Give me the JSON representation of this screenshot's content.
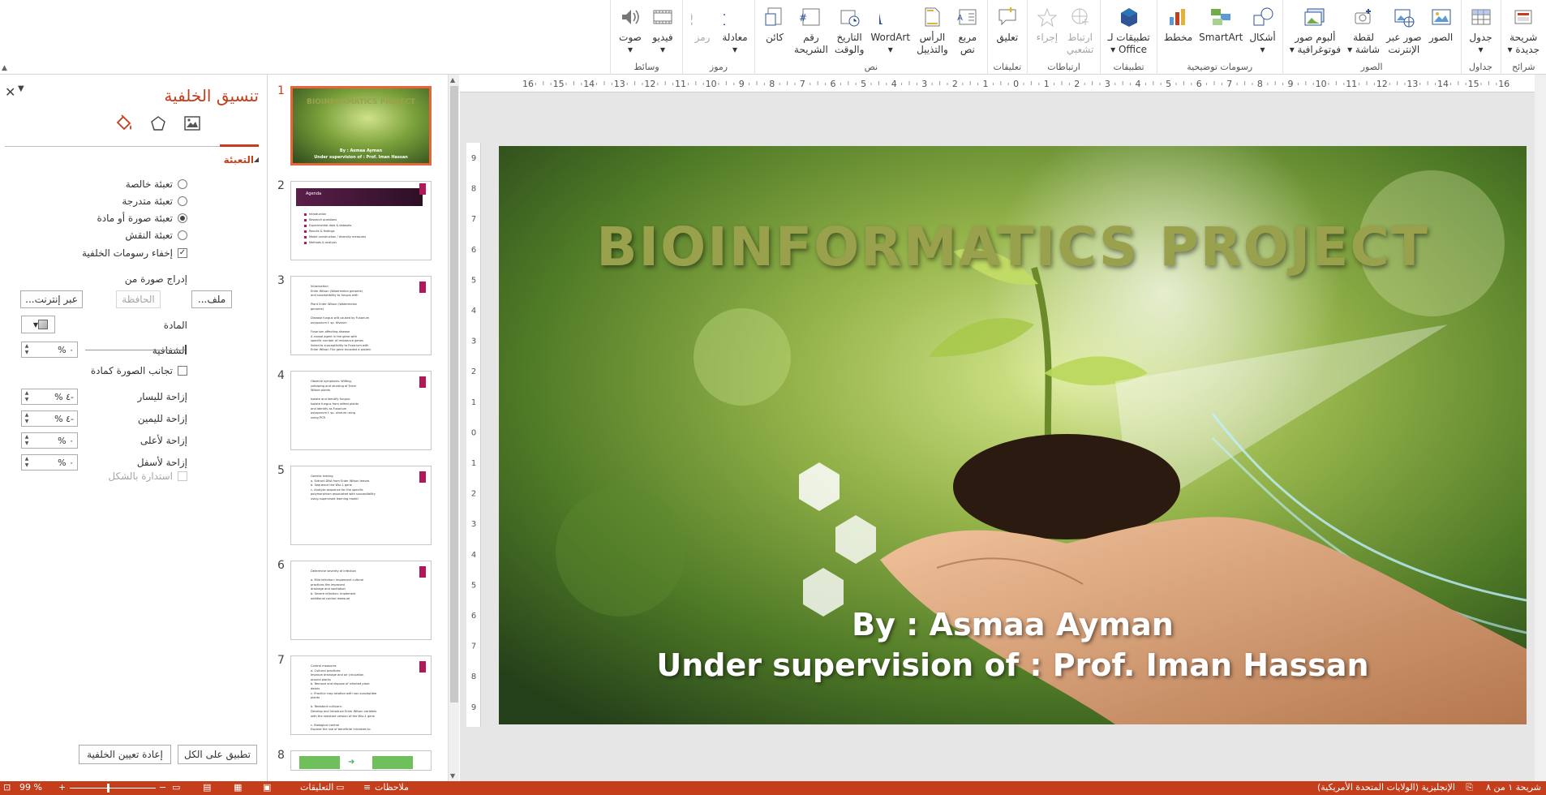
{
  "ribbon": {
    "groups": [
      {
        "label": "شرائح",
        "items": [
          {
            "name": "new-slide",
            "icon": "new-slide-icon",
            "label": "شريحة\nجديدة ▾"
          }
        ]
      },
      {
        "label": "جداول",
        "items": [
          {
            "name": "table",
            "icon": "table-icon",
            "label": "جدول\n▾"
          }
        ]
      },
      {
        "label": "الصور",
        "items": [
          {
            "name": "pictures",
            "icon": "picture-icon",
            "label": "الصور"
          },
          {
            "name": "online-pictures",
            "icon": "online-picture-icon",
            "label": "صور عبر\nالإنترنت"
          },
          {
            "name": "screenshot",
            "icon": "screenshot-icon",
            "label": "لقطة\nشاشة ▾"
          },
          {
            "name": "photo-album",
            "icon": "photo-album-icon",
            "label": "ألبوم صور\nفوتوغرافية ▾"
          }
        ]
      },
      {
        "label": "رسومات توضيحية",
        "items": [
          {
            "name": "shapes",
            "icon": "shapes-icon",
            "label": "أشكال\n▾"
          },
          {
            "name": "smartart",
            "icon": "smartart-icon",
            "label": "SmartArt"
          },
          {
            "name": "chart",
            "icon": "chart-icon",
            "label": "مخطط"
          }
        ]
      },
      {
        "label": "تطبيقات",
        "items": [
          {
            "name": "office-apps",
            "icon": "office-apps-icon",
            "label": "تطبيقات لـ\nOffice ▾"
          }
        ]
      },
      {
        "label": "ارتباطات",
        "items": [
          {
            "name": "hyperlink",
            "icon": "hyperlink-icon",
            "label": "ارتباط\nتشعبي",
            "disabled": true
          },
          {
            "name": "action",
            "icon": "action-icon",
            "label": "إجراء",
            "disabled": true
          }
        ]
      },
      {
        "label": "تعليقات",
        "items": [
          {
            "name": "comment",
            "icon": "comment-icon",
            "label": "تعليق"
          }
        ]
      },
      {
        "label": "نص",
        "items": [
          {
            "name": "text-box",
            "icon": "text-box-icon",
            "label": "مربع\nنص"
          },
          {
            "name": "header-footer",
            "icon": "header-footer-icon",
            "label": "الرأس\nوالتذييل"
          },
          {
            "name": "wordart",
            "icon": "wordart-icon",
            "label": "WordArt\n▾"
          },
          {
            "name": "date-time",
            "icon": "date-time-icon",
            "label": "التاريخ\nوالوقت"
          },
          {
            "name": "slide-number",
            "icon": "slide-number-icon",
            "label": "رقم\nالشريحة"
          },
          {
            "name": "object",
            "icon": "object-icon",
            "label": "كائن"
          }
        ]
      },
      {
        "label": "رموز",
        "items": [
          {
            "name": "equation",
            "icon": "equation-icon",
            "label": "معادلة\n▾"
          },
          {
            "name": "symbol",
            "icon": "symbol-icon",
            "label": "رمز",
            "disabled": true
          }
        ]
      },
      {
        "label": "وسائط",
        "items": [
          {
            "name": "video",
            "icon": "video-icon",
            "label": "فيديو\n▾"
          },
          {
            "name": "audio",
            "icon": "audio-icon",
            "label": "صوت\n▾"
          }
        ]
      }
    ]
  },
  "pane": {
    "title": "تنسيق الخلفية",
    "tabs": [
      "fill-icon",
      "effects-icon",
      "picture-icon"
    ],
    "section": "التعبئة",
    "fill_options": [
      {
        "label": "تعبئة خالصة",
        "checked": false
      },
      {
        "label": "تعبئة متدرجة",
        "checked": false
      },
      {
        "label": "تعبئة صورة أو مادة",
        "checked": true
      },
      {
        "label": "تعبئة النقش",
        "checked": false
      }
    ],
    "hide_graphics": {
      "label": "إخفاء رسومات الخلفية",
      "checked": true
    },
    "insert_from": "إدراج صورة من",
    "file_button": "ملف...",
    "clipboard_button": "الحافظة",
    "online_button": "عبر إنترنت...",
    "texture_label": "المادة",
    "transparency_label": "الشفافية",
    "transparency_value": "٠ %",
    "tile_label": "تجانب الصورة كمادة",
    "offsets": [
      {
        "label": "إزاحة لليسار",
        "value": "-٤ %"
      },
      {
        "label": "إزاحة لليمين",
        "value": "-٤ %"
      },
      {
        "label": "إزاحة لأعلى",
        "value": "٠ %"
      },
      {
        "label": "إزاحة لأسفل",
        "value": "٠ %"
      }
    ],
    "rotate_label": "استدارة بالشكل",
    "apply_all": "تطبيق على الكل",
    "reset": "إعادة تعيين الخلفية"
  },
  "thumbnails": [
    {
      "num": "1",
      "type": "title",
      "title": "BIOINFORMATICS PROJECT",
      "sub1": "By : Asmaa Ayman",
      "sub2": "Under supervision of : Prof. Iman Hassan"
    },
    {
      "num": "2",
      "type": "agenda",
      "heading": "Agenda",
      "lines": [
        "Introduction",
        "Research questions",
        "Experimental data & datasets",
        "Results & findings",
        "Model construction / diversity measures",
        "Methods & analysis"
      ]
    },
    {
      "num": "3",
      "type": "text",
      "lines": [
        "Introduction",
        "Enter Wilson (Watermelon genome)",
        "and susceptibility to fungus with",
        "",
        "Plant Enter Wilson (Watermelon",
        "genome)",
        "",
        "Disease fungus wilt caused by Fusarium",
        "oxysporum f. sp. Niveum",
        "",
        "Fusarium affecting disease",
        "A causal agent in the gene with",
        "specific number of resistance genes",
        "linked to susceptibility to Fusarium with",
        "Enter Wilson The gene encoded a protein"
      ]
    },
    {
      "num": "4",
      "type": "text",
      "lines": [
        "Observe symptoms: Wilting,",
        "yellowing and stunting of Enter",
        "Wilson plants",
        "",
        "Isolate and identify fungus:",
        "Isolate fungus from wilted plants",
        "and identify as Fusarium",
        "oxysporum f. sp. niveum using",
        "using PCR"
      ]
    },
    {
      "num": "5",
      "type": "text",
      "lines": [
        "Genetic testing",
        "a. Extract DNA from Enter Wilson leaves",
        "b. Sequence the Wsr-1 gene",
        "c. Analyze sequence for the specific",
        "polymorphism associated with susceptibility",
        "using supervised learning model"
      ]
    },
    {
      "num": "6",
      "type": "text",
      "lines": [
        "Determine severity of infection",
        "",
        "a. Mild infection: implement cultural",
        "practices like improved",
        "drainage and sanitation",
        "b. Severe infection: implement",
        "additional control measure"
      ]
    },
    {
      "num": "7",
      "type": "text",
      "lines": [
        "Control measures",
        "a. Cultural practices:",
        "Improve drainage and air circulation",
        "around plants",
        "b. Remove and dispose of infected plant",
        "debris",
        "c. Practice crop rotation with non-susceptible",
        "plants",
        "",
        "b. Resistant cultivars:",
        "Develop and introduce Enter Wilson varieties",
        "with the resistant version of the Wsr-1 gene",
        "",
        "c. Biological control",
        "Explore the use of beneficial microbes to"
      ]
    },
    {
      "num": "8",
      "type": "flow",
      "lines": []
    }
  ],
  "slide": {
    "title": "BIOINFORMATICS PROJECT",
    "by": "By : Asmaa Ayman",
    "supervision": "Under supervision of : Prof. Iman Hassan"
  },
  "ruler": {
    "h_labels": [
      "16",
      "15",
      "14",
      "13",
      "12",
      "11",
      "10",
      "9",
      "8",
      "7",
      "6",
      "5",
      "4",
      "3",
      "2",
      "1",
      "0",
      "1",
      "2",
      "3",
      "4",
      "5",
      "6",
      "7",
      "8",
      "9",
      "10",
      "11",
      "12",
      "13",
      "14",
      "15",
      "16"
    ],
    "v_labels": [
      "9",
      "8",
      "7",
      "6",
      "5",
      "4",
      "3",
      "2",
      "1",
      "0",
      "1",
      "2",
      "3",
      "4",
      "5",
      "6",
      "7",
      "8",
      "9"
    ]
  },
  "status": {
    "slide_of": "شريحة ١ من ٨",
    "language": "الإنجليزية (الولايات المتحدة الأمريكية)",
    "notes": "ملاحظات",
    "comments": "التعليقات",
    "zoom": "99 %"
  },
  "colors": {
    "accent": "#c43e1c",
    "status_bar": "#c43e1c",
    "title_green": "#9aa14d"
  }
}
